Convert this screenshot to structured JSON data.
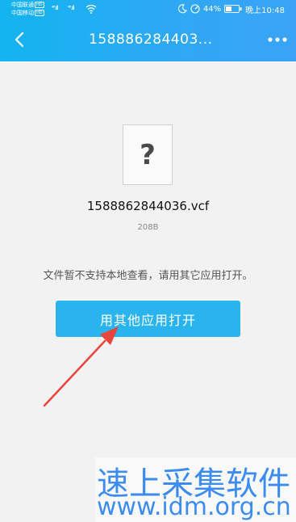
{
  "status_bar": {
    "carrier1": "中国联通",
    "carrier2": "中国移动",
    "hd_label": "HD",
    "signal1": "⁴⁶.ıll",
    "signal2": "⁴⁶.ıll",
    "battery": "44%",
    "time": "晚上10:48"
  },
  "nav": {
    "title": "158886284403..."
  },
  "file": {
    "icon_glyph": "?",
    "name": "1588862844036.vcf",
    "size": "208B"
  },
  "notice": "文件暂不支持本地查看，请用其它应用打开。",
  "open_button_label": "用其他应用打开",
  "watermark": {
    "line1": "速上采集软件",
    "line2": "www.idm.org.cn"
  },
  "colors": {
    "header": "#2fa8f4",
    "button": "#2ab4ee",
    "arrow": "#e8453c"
  }
}
